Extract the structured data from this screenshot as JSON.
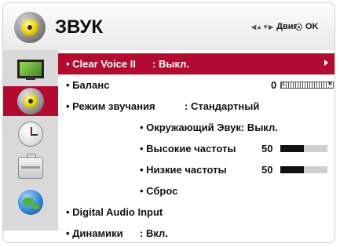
{
  "header": {
    "title": "ЗВУК",
    "nav_label": "Двиг",
    "ok_label": "OK"
  },
  "sidebar": {
    "items": [
      {
        "name": "tv-icon",
        "active": false
      },
      {
        "name": "speaker-icon",
        "active": true
      },
      {
        "name": "clock-icon",
        "active": false
      },
      {
        "name": "briefcase-icon",
        "active": false
      },
      {
        "name": "globe-icon",
        "active": false
      }
    ]
  },
  "menu": {
    "clear_voice": {
      "label": "• Clear Voice II",
      "value": ": Выкл."
    },
    "balance": {
      "label": "• Баланс",
      "value": "0",
      "left": "L",
      "right": "R"
    },
    "sound_mode": {
      "label": "• Режим звучания",
      "value": ": Стандартный"
    },
    "surround": {
      "label": "• Окружающий Эвук: Выкл."
    },
    "treble": {
      "label": "• Высокие частоты",
      "value": "50",
      "level_pct": 50
    },
    "bass": {
      "label": "• Низкие частоты",
      "value": "50",
      "level_pct": 50
    },
    "reset": {
      "label": "• Сброс"
    },
    "digital_audio": {
      "label": "• Digital Audio Input"
    },
    "speakers": {
      "label": "• Динамики",
      "value": ": Вкл."
    }
  },
  "colors": {
    "accent": "#b30b2f",
    "sidebar_bg": "#d9d9d9"
  }
}
